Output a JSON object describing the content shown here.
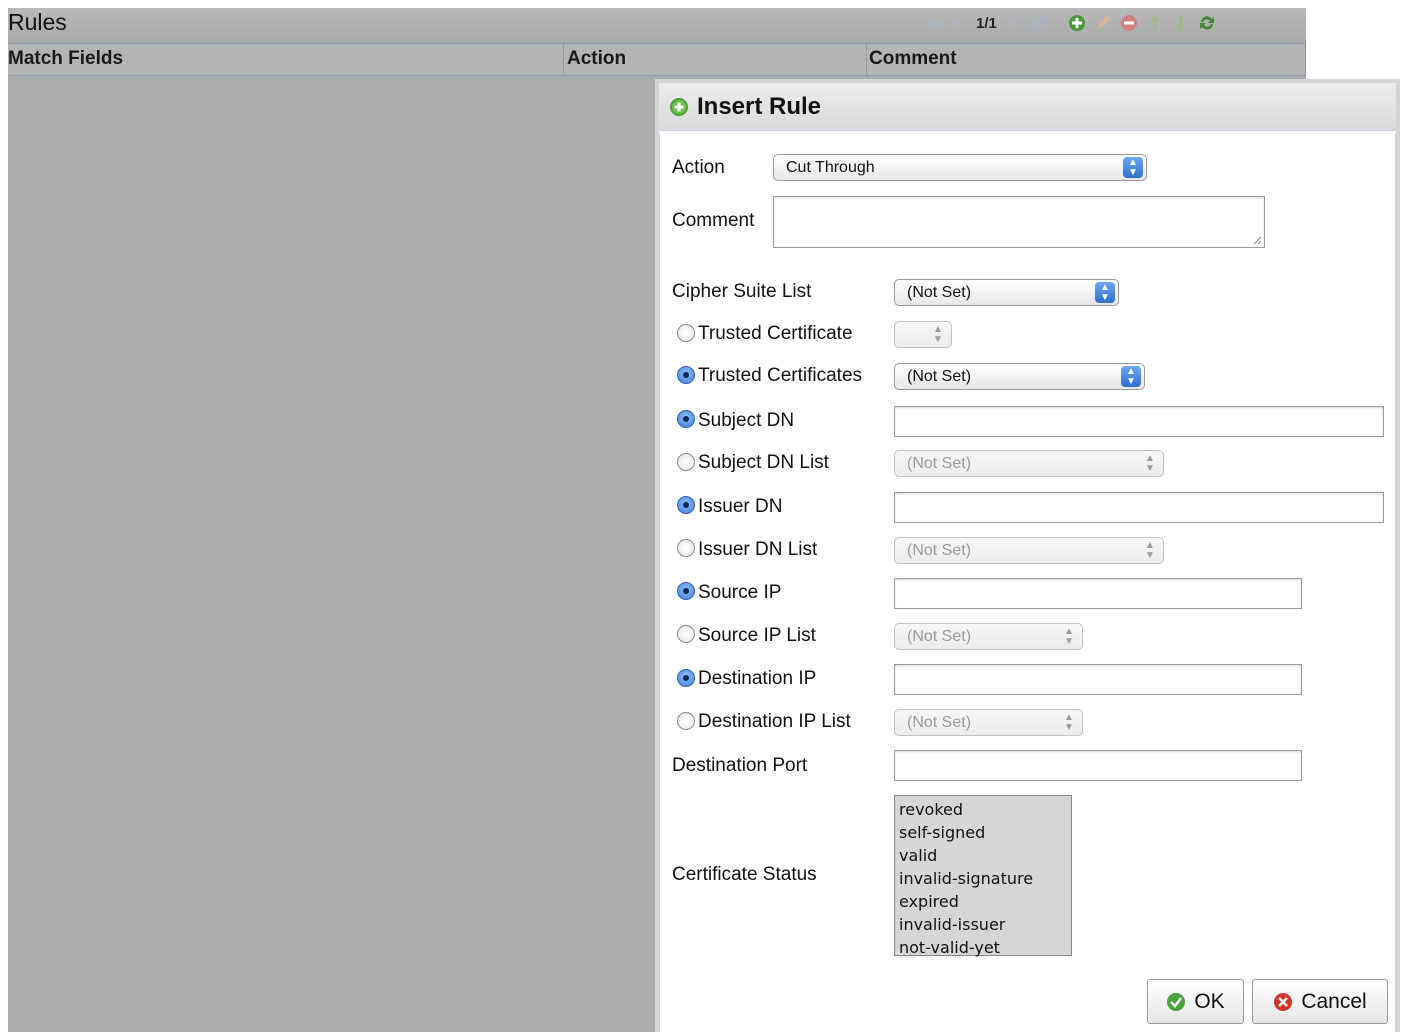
{
  "grid": {
    "title": "Rules",
    "pager": "1/1",
    "columns": [
      "Match Fields",
      "Action",
      "Comment"
    ]
  },
  "dialog": {
    "title": "Insert Rule",
    "action_label": "Action",
    "action_value": "Cut Through",
    "comment_label": "Comment",
    "comment_value": "",
    "cipher_label": "Cipher Suite List",
    "cipher_value": "(Not Set)",
    "trusted_cert_label": "Trusted Certificate",
    "trusted_cert_value": "",
    "trusted_certs_label": "Trusted Certificates",
    "trusted_certs_value": "(Not Set)",
    "subject_dn_label": "Subject DN",
    "subject_dn_value": "",
    "subject_dn_list_label": "Subject DN List",
    "subject_dn_list_value": "(Not Set)",
    "issuer_dn_label": "Issuer DN",
    "issuer_dn_value": "",
    "issuer_dn_list_label": "Issuer DN List",
    "issuer_dn_list_value": "(Not Set)",
    "source_ip_label": "Source IP",
    "source_ip_value": "",
    "source_ip_list_label": "Source IP List",
    "source_ip_list_value": "(Not Set)",
    "dest_ip_label": "Destination IP",
    "dest_ip_value": "",
    "dest_ip_list_label": "Destination IP List",
    "dest_ip_list_value": "(Not Set)",
    "dest_port_label": "Destination Port",
    "dest_port_value": "",
    "cert_status_label": "Certificate Status",
    "cert_status_options": [
      "revoked",
      "self-signed",
      "valid",
      "invalid-signature",
      "expired",
      "invalid-issuer",
      "not-valid-yet"
    ],
    "ok_label": "OK",
    "cancel_label": "Cancel"
  }
}
